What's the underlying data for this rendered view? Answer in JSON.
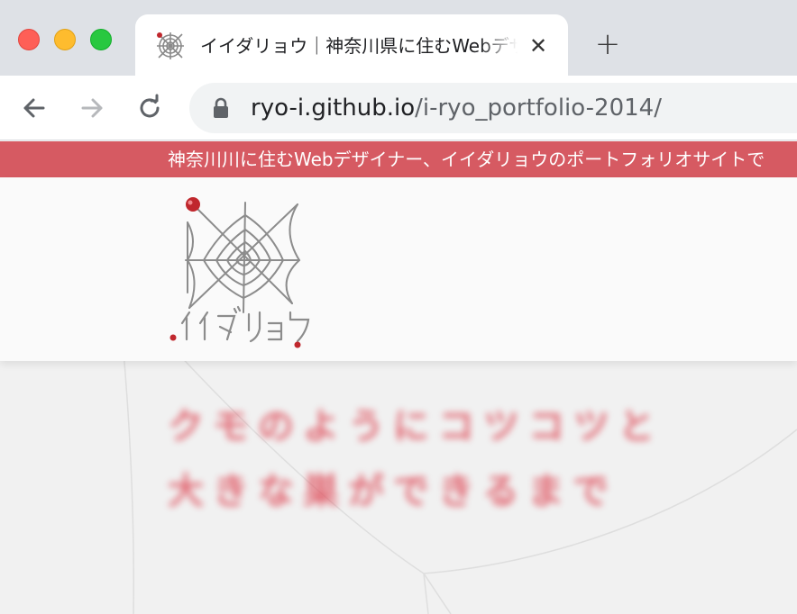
{
  "browser": {
    "tab": {
      "title": "イイダリョウ｜神奈川県に住むWebデザイナー",
      "close_glyph": "✕",
      "favicon": "spider-web-icon"
    },
    "new_tab_glyph": "+",
    "window_controls": [
      "close",
      "minimize",
      "zoom"
    ],
    "url": {
      "host": "ryo-i.github.io",
      "path": "/i-ryo_portfolio-2014/"
    }
  },
  "page": {
    "announcement": "神奈川川に住むWebデザイナー、イイダリョウのポートフォリオサイトで",
    "logo_text": "イイダリョウ",
    "catchphrase": {
      "line1": "クモのようにコツコツと",
      "line2": "大きな巣ができるまで"
    }
  },
  "colors": {
    "accent": "#d65a62",
    "catch_text": "#e05a66",
    "tabstrip": "#dee1e6",
    "omnibox": "#f1f3f4"
  }
}
